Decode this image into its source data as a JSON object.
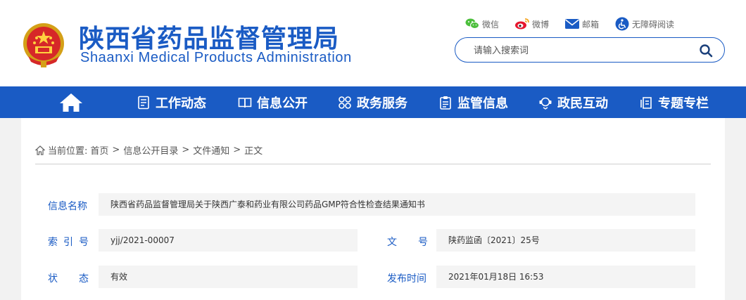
{
  "header": {
    "site_name_cn": "陕西省药品监督管理局",
    "site_name_en": "Shaanxi Medical Products Administration",
    "emblem_icon": "national-emblem-icon"
  },
  "tools": [
    {
      "label": "微信",
      "icon": "wechat-icon"
    },
    {
      "label": "微博",
      "icon": "weibo-icon"
    },
    {
      "label": "邮箱",
      "icon": "mail-icon"
    },
    {
      "label": "无障碍阅读",
      "icon": "accessibility-icon"
    }
  ],
  "search": {
    "placeholder": "请输入搜索词",
    "icon": "search-icon"
  },
  "nav": {
    "home_icon": "home-icon",
    "items": [
      {
        "label": "工作动态",
        "icon": "document-list-icon"
      },
      {
        "label": "信息公开",
        "icon": "open-book-icon"
      },
      {
        "label": "政务服务",
        "icon": "grid-circles-icon"
      },
      {
        "label": "监管信息",
        "icon": "clipboard-icon"
      },
      {
        "label": "政民互动",
        "icon": "interaction-icon"
      },
      {
        "label": "专题专栏",
        "icon": "topic-docs-icon"
      }
    ]
  },
  "breadcrumb": {
    "prefix": "当前位置:",
    "items": [
      "首页",
      "信息公开目录",
      "文件通知",
      "正文"
    ],
    "separator": ">"
  },
  "info": {
    "name_label": "信息名称",
    "name_value": "陕西省药品监督管理局关于陕西广泰和药业有限公司药品GMP符合性检查结果通知书",
    "index_label": "索引号",
    "index_value": "yjj/2021-00007",
    "doc_no_label": "文号",
    "doc_no_value": "陕药监函〔2021〕25号",
    "status_label": "状态",
    "status_value": "有效",
    "publish_label": "发布时间",
    "publish_value": "2021年01月18日 16:53"
  },
  "colors": {
    "brand": "#1a5bc4",
    "nav_bg": "#1a5bc4",
    "page_bg": "#f2f2f2",
    "field_bg": "#f4f4f4"
  }
}
